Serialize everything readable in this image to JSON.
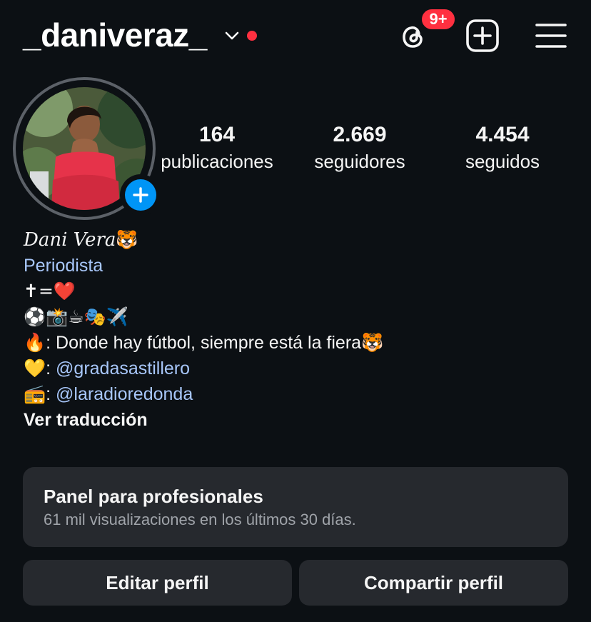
{
  "header": {
    "username": "_daniveraz_",
    "notification_badge": "9+",
    "accent_red": "#ff3040"
  },
  "stats": [
    {
      "value": "164",
      "label": "publicaciones"
    },
    {
      "value": "2.669",
      "label": "seguidores"
    },
    {
      "value": "4.454",
      "label": "seguidos"
    }
  ],
  "bio": {
    "display_name": "Dani Vera",
    "name_emoji": "🐯",
    "category": "Periodista",
    "line1": "✝=❤️",
    "line2": "⚽📸☕🎭✈️",
    "line3_emoji": "🔥",
    "line3_text": ": Donde hay fútbol, siempre está la fiera",
    "line3_end_emoji": "🐯",
    "line4_emoji": "💛",
    "line4_sep": ": ",
    "line4_mention": "@gradasastillero",
    "line5_emoji": "📻",
    "line5_sep": ": ",
    "line5_mention": "@laradioredonda",
    "translate": "Ver traducción"
  },
  "panel": {
    "title": "Panel para profesionales",
    "subtitle": "61 mil visualizaciones en los últimos 30 días."
  },
  "buttons": {
    "edit": "Editar perfil",
    "share": "Compartir perfil"
  },
  "icons": {
    "threads": "threads-icon",
    "add": "add-post-icon",
    "menu": "hamburger-menu-icon",
    "chevron": "chevron-down-icon",
    "avatar_add": "plus-icon"
  },
  "colors": {
    "background": "#0c1014",
    "surface": "#26292e",
    "link": "#a8c7fa",
    "primary_blue": "#0095f6"
  }
}
